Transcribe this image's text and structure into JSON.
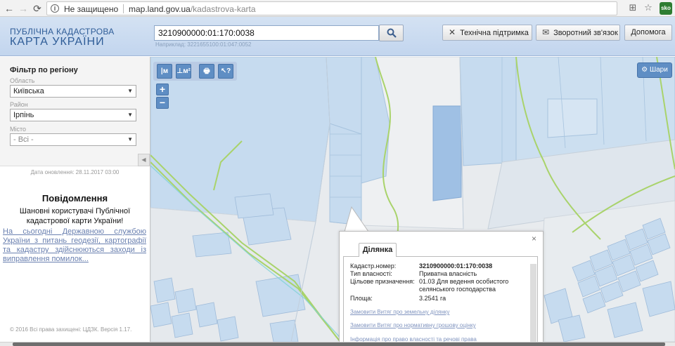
{
  "browser": {
    "back_icon": "arrow-left-icon",
    "forward_icon": "arrow-right-icon",
    "reload_icon": "reload-icon",
    "security_label": "Не защищено",
    "url_host": "map.land.gov.ua",
    "url_path": "/kadastrova-karta",
    "translate_icon": "translate-icon",
    "star_icon": "star-icon",
    "extension_label": "sko"
  },
  "header": {
    "logo_line1": "ПУБЛІЧНА КАДАСТРОВА",
    "logo_line2": "КАРТА УКРАЇНИ",
    "search_value": "3210900000:01:170:0038",
    "search_hint": "Наприклад: 3221655100:01:047:0052",
    "support_label": "Технічна підтримка",
    "feedback_label": "Зворотний зв'язок",
    "help_label": "Допомога"
  },
  "sidebar": {
    "filter_title": "Фільтр по регіону",
    "region_label": "Область",
    "region_value": "Київська",
    "district_label": "Район",
    "district_value": "Ірпінь",
    "city_label": "Місто",
    "city_value": "- Всі -",
    "update_date": "Дата оновлення: 28.11.2017 03:00",
    "notice_title": "Повідомлення",
    "notice_body": "Шановні користувачі Публічної кадастрової карти України!",
    "notice_link": "На сьогодні Державною службою України з питань геодезії, картографії та кадастру здійснюються заходи із виправлення помилок...",
    "copyright": "© 2016 Всі права захищені: ЦДЗК. Версія 1.17."
  },
  "map": {
    "tools": [
      {
        "label": "|м",
        "icon": "measure-distance-icon"
      },
      {
        "label": "⊥м²",
        "icon": "measure-area-icon"
      },
      {
        "label": "🖶",
        "icon": "print-icon"
      },
      {
        "label": "↖?",
        "icon": "identify-icon"
      }
    ],
    "zoom_in": "+",
    "zoom_out": "−",
    "layers_label": "Шари"
  },
  "popup": {
    "tab_label": "Ділянка",
    "close_label": "×",
    "rows": [
      {
        "label": "Кадастр.номер:",
        "value": "3210900000:01:170:0038"
      },
      {
        "label": "Тип власності:",
        "value": "Приватна власність"
      },
      {
        "label": "Цільове призначення:",
        "value": "01.03 Для ведення особистого селянського господарства"
      },
      {
        "label": "Площа:",
        "value": "3.2541 га"
      }
    ],
    "links": [
      "Замовити Витяг про земельну ділянку",
      "Замовити Витяг про нормативну грошову оцінку",
      "Інформація про право власності та речові права"
    ]
  },
  "colors": {
    "header_bg": "#c7d8ef",
    "accent": "#5f8ec4",
    "parcel_fill": "#bcd4ec",
    "road_green": "#a9d36b",
    "link": "#7c92c0"
  }
}
